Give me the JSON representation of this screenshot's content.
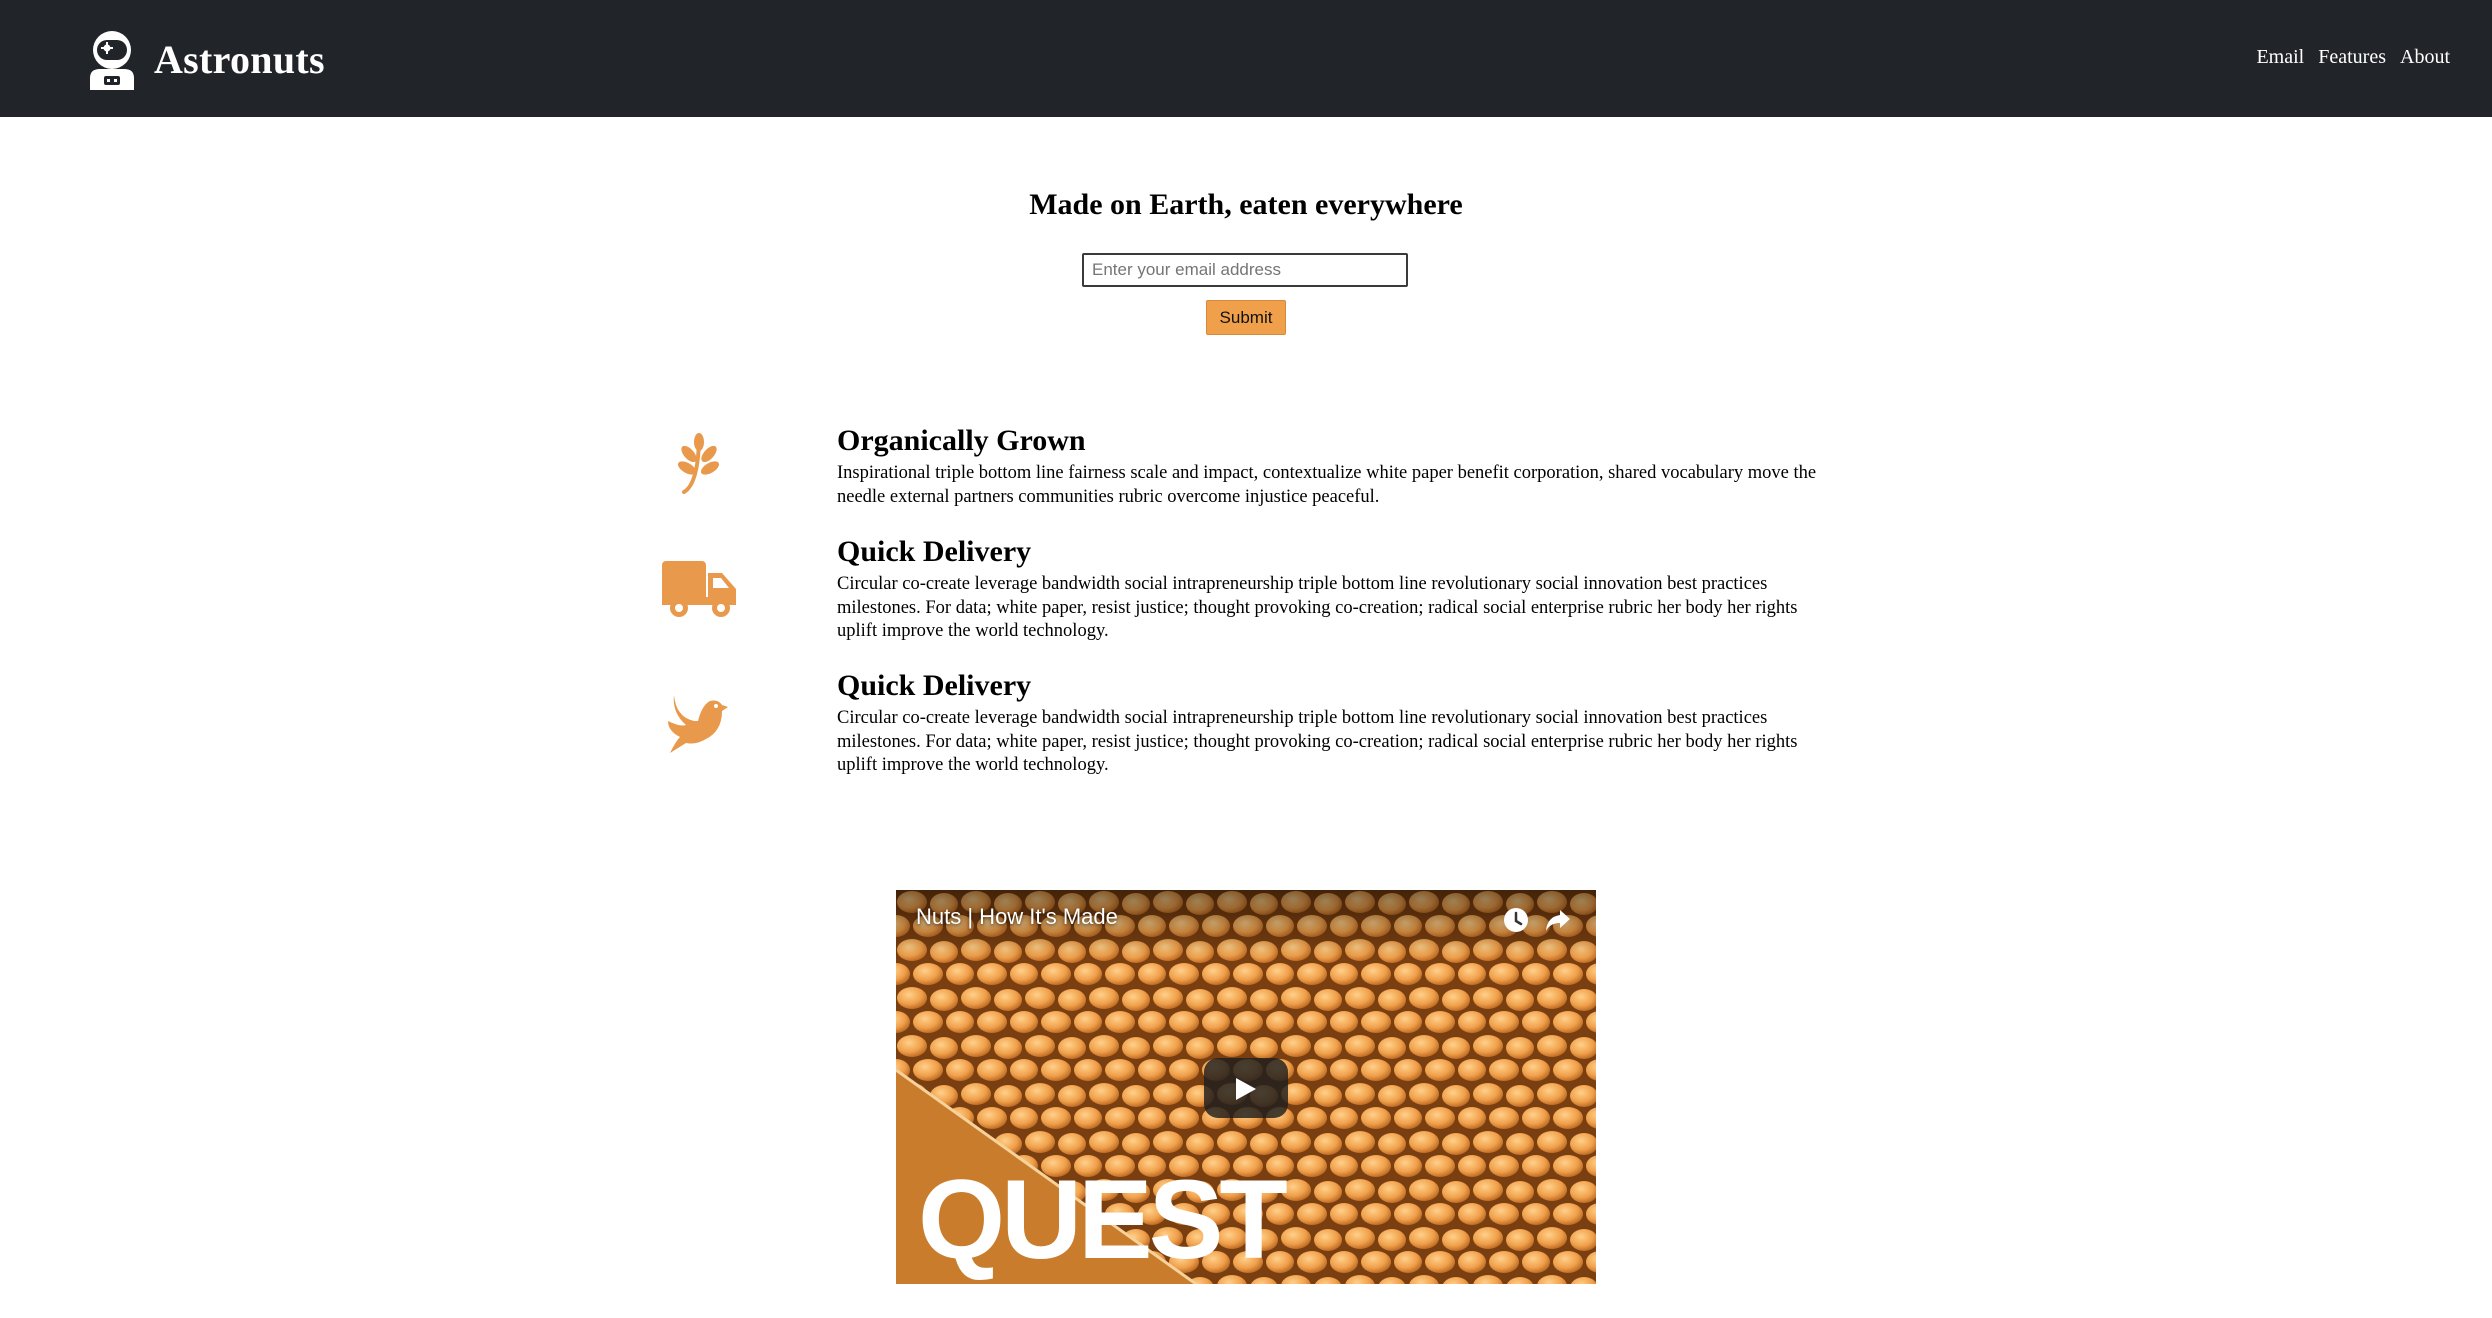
{
  "header": {
    "brand_name": "Astronuts",
    "nav": [
      {
        "label": "Email"
      },
      {
        "label": "Features"
      },
      {
        "label": "About"
      }
    ]
  },
  "hero": {
    "title": "Made on Earth, eaten everywhere",
    "email_placeholder": "Enter your email address",
    "email_value": "",
    "submit_label": "Submit"
  },
  "features": [
    {
      "icon": "leaf-sprout-icon",
      "title": "Organically Grown",
      "description": "Inspirational triple bottom line fairness scale and impact, contextualize white paper benefit corporation, shared vocabulary move the needle external partners communities rubric overcome injustice peaceful."
    },
    {
      "icon": "delivery-truck-icon",
      "title": "Quick Delivery",
      "description": "Circular co-create leverage bandwidth social intrapreneurship triple bottom line revolutionary social innovation best practices milestones. For data; white paper, resist justice; thought provoking co-creation; radical social enterprise rubric her body her rights uplift improve the world technology."
    },
    {
      "icon": "dove-icon",
      "title": "Quick Delivery",
      "description": "Circular co-create leverage bandwidth social intrapreneurship triple bottom line revolutionary social innovation best practices milestones. For data; white paper, resist justice; thought provoking co-creation; radical social enterprise rubric her body her rights uplift improve the world technology."
    }
  ],
  "video": {
    "title": "Nuts | How It's Made",
    "watermark": "QUEST",
    "icons": [
      "watch-later-icon",
      "share-icon",
      "play-icon"
    ]
  },
  "colors": {
    "header_bg": "#212428",
    "accent": "#f0a04b",
    "icon_orange": "#e9994b"
  }
}
